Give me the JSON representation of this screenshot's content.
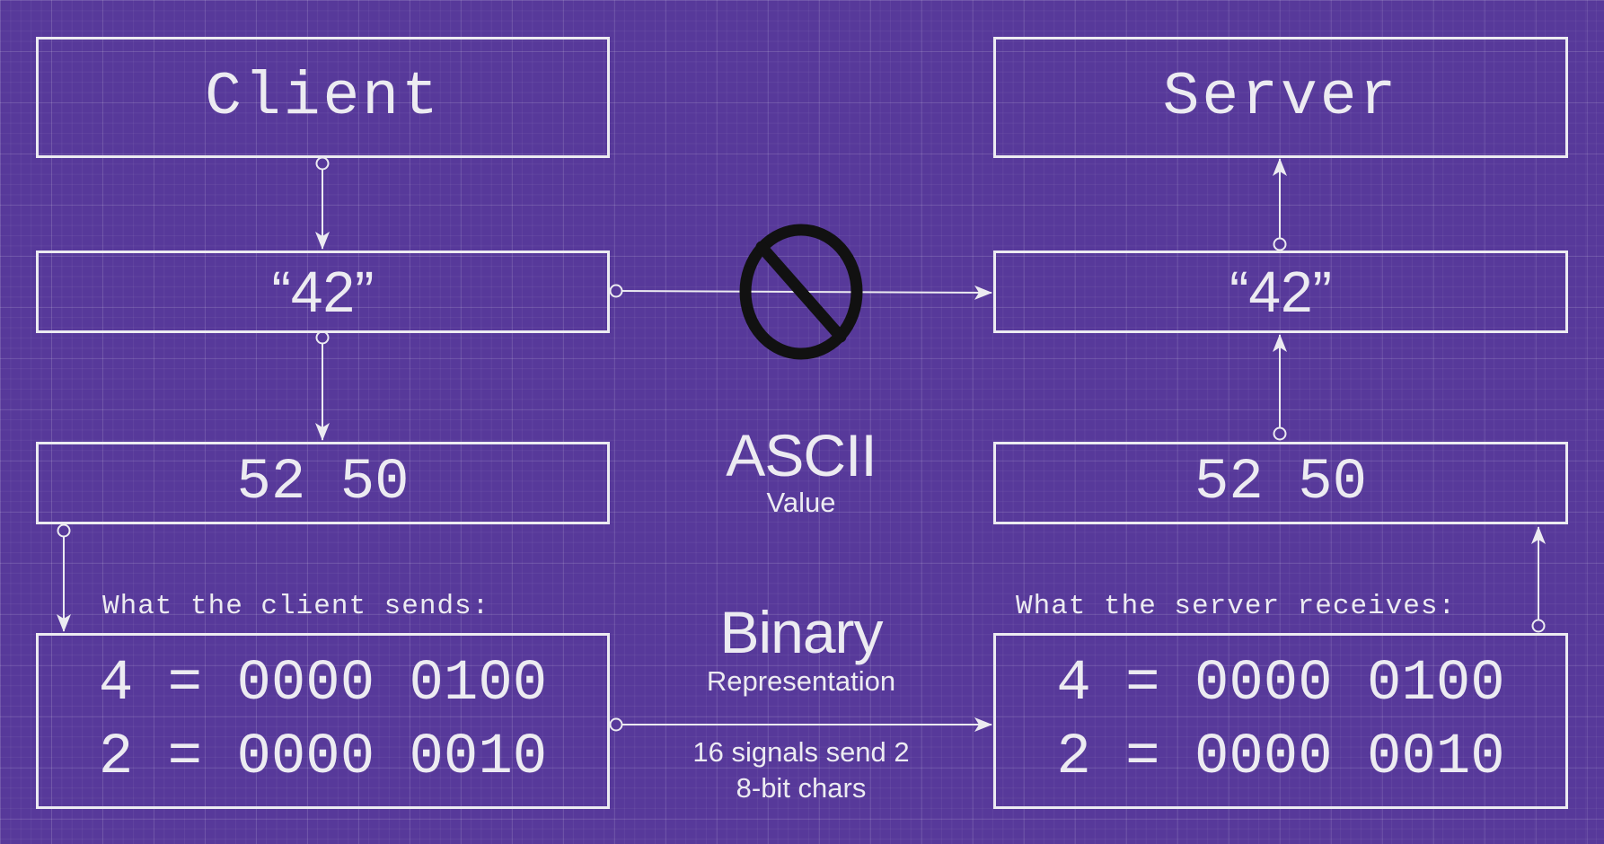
{
  "client": {
    "title": "Client",
    "string_value": "“42”",
    "ascii_value": "52 50"
  },
  "server": {
    "title": "Server",
    "string_value": "“42”",
    "ascii_value": "52 50"
  },
  "ascii_label": {
    "main": "ASCII",
    "sub": "Value"
  },
  "binary_label": {
    "main": "Binary",
    "sub": "Representation"
  },
  "transmission_note": {
    "line1": "16 signals send 2",
    "line2": "8-bit chars"
  },
  "client_caption": "What the client sends:",
  "server_caption": "What the server receives:",
  "client_binary": {
    "line1": "4 = 0000 0100",
    "line2": "2 = 0000 0010"
  },
  "server_binary": {
    "line1": "4 = 0000 0100",
    "line2": "2 = 0000 0010"
  },
  "prohibited_icon": "no-entry-icon",
  "colors": {
    "background": "#57399a",
    "line": "#ecebf1",
    "prohibited": "#111111"
  }
}
